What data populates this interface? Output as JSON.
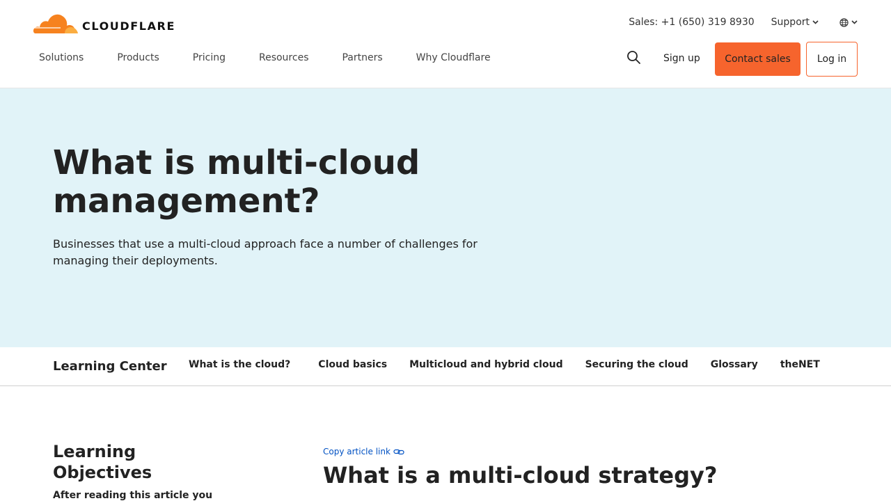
{
  "header": {
    "logo_text": "CLOUDFLARE",
    "sales": "Sales: +1 (650) 319 8930",
    "support": "Support",
    "nav": [
      "Solutions",
      "Products",
      "Pricing",
      "Resources",
      "Partners",
      "Why Cloudflare"
    ],
    "signup": "Sign up",
    "contact": "Contact sales",
    "login": "Log in",
    "icons": {
      "search": "search-icon",
      "globe": "globe-icon",
      "chevron": "chevron-down-icon"
    }
  },
  "hero": {
    "title": "What is multi-cloud management?",
    "subtitle": "Businesses that use a multi-cloud approach face a number of challenges for managing their deployments."
  },
  "subnav": {
    "title": "Learning Center",
    "links": [
      "What is the cloud?",
      "Cloud basics",
      "Multicloud and hybrid cloud",
      "Securing the cloud",
      "Glossary",
      "theNET"
    ]
  },
  "content": {
    "objectives_title": "Learning Objectives",
    "objectives_intro": "After reading this article you",
    "copy_link": "Copy article link",
    "article_heading": "What is a multi-cloud strategy?"
  },
  "colors": {
    "accent": "#f6642d",
    "hero_bg": "#e1f3f8",
    "link": "#0051c3"
  }
}
